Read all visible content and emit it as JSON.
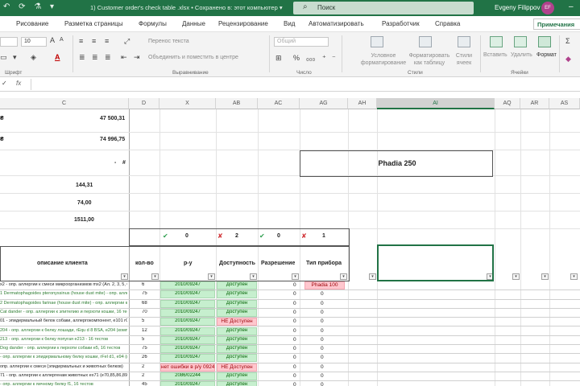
{
  "titlebar": {
    "quick_access": "↶ ⟳ ⚗ ▾",
    "document": "1) Customer order's check table .xlsx • Сохранено в: этот компьютер ▾",
    "search_placeholder": "Поиск",
    "user_name": "Evgeny Filippov",
    "avatar_initials": "EF"
  },
  "tabs": [
    "Рисование",
    "Разметка страницы",
    "Формулы",
    "Данные",
    "Рецензирование",
    "Вид",
    "Автоматизировать",
    "Разработчик",
    "Справка"
  ],
  "comments_button": "Примечания",
  "ribbon": {
    "font_size": "10",
    "wrap_text": "Перенос текста",
    "merge_center": "Объединить и поместить в центре",
    "number_format": "Общий",
    "conditional_format": "Условное форматирование",
    "format_as_table": "Форматировать как таблицу",
    "cell_styles": "Стили ячеек",
    "insert": "Вставить",
    "delete": "Удалить",
    "format": "Формат",
    "group_font": "Шрифт",
    "group_align": "Выравнивание",
    "group_number": "Число",
    "group_styles": "Стили",
    "group_cells": "Ячейки"
  },
  "formula_bar": {
    "fx": "fx"
  },
  "columns": [
    {
      "label": "C",
      "selected": false
    },
    {
      "label": "D",
      "selected": false
    },
    {
      "label": "X",
      "selected": false
    },
    {
      "label": "AB",
      "selected": false
    },
    {
      "label": "AC",
      "selected": false
    },
    {
      "label": "AG",
      "selected": false
    },
    {
      "label": "AH",
      "selected": false
    },
    {
      "label": "AI",
      "selected": true
    },
    {
      "label": "AQ",
      "selected": false
    },
    {
      "label": "AR",
      "selected": false
    },
    {
      "label": "AS",
      "selected": false
    }
  ],
  "summary": {
    "value1": "47 500,31",
    "value2": "74 996,75",
    "value3": "-",
    "hash": "#",
    "value4": "144,31",
    "value5": "74,00",
    "value6": "1511,00"
  },
  "phadia_title": "Phadia 250",
  "counters": {
    "x_ok": "✔",
    "x_value": "0",
    "ab_bad": "✘",
    "ab_value": "2",
    "ac_ok": "✔",
    "ac_value": "0",
    "ag_bad": "✘",
    "ag_value": "1"
  },
  "headers": {
    "c": "описание клиента",
    "d": "кол-во",
    "x": "р-у",
    "ab": "Доступность",
    "ac": "Разрешение",
    "ag": "Тип прибора"
  },
  "filter_glyph": "▾",
  "rows": [
    {
      "c": "х2 - опр. аллергии к смеси микроорганизмов mx2 (Ал. 2, 3, 5, 6,",
      "d": "6",
      "x": "2010/09247",
      "ab": "Доступен",
      "ab_bad": false,
      "ac": "0",
      "ag": "Phadia 100",
      "ag_bad": true,
      "c_green": false,
      "x_bad": false
    },
    {
      "c": "1 Dermatophagoides pteronyssinus (house dust mite) - опр. аллерги",
      "d": "75",
      "x": "2010/09247",
      "ab": "Доступен",
      "ab_bad": false,
      "ac": "0",
      "ag": "0",
      "ag_bad": false,
      "c_green": true,
      "x_bad": false
    },
    {
      "c": "2 Dermatophagoides farinae (house dust mite) - опр. аллергии к",
      "d": "68",
      "x": "2010/09247",
      "ab": "Доступен",
      "ab_bad": false,
      "ac": "0",
      "ag": "0",
      "ag_bad": false,
      "c_green": true,
      "x_bad": false
    },
    {
      "c": "Cat dander - опр. аллергии к эпителию и перхоти кошки, 16 тес",
      "d": "70",
      "x": "2010/09247",
      "ab": "Доступен",
      "ab_bad": false,
      "ac": "0",
      "ag": "0",
      "ag_bad": false,
      "c_green": true,
      "x_bad": false
    },
    {
      "c": "01 - эпидермальный белок собаки, аллергокомпонент, e101 rCa",
      "d": "5",
      "x": "2010/09247",
      "ab": "НЕ Доступен",
      "ab_bad": true,
      "ac": "0",
      "ag": "0",
      "ag_bad": false,
      "c_green": false,
      "x_bad": false
    },
    {
      "c": "204 - опр. аллергии к белку лошади, rEqu d 8 BSA, e204 (комп",
      "d": "12",
      "x": "2010/09247",
      "ab": "Доступен",
      "ab_bad": false,
      "ac": "0",
      "ag": "0",
      "ag_bad": false,
      "c_green": true,
      "x_bad": false
    },
    {
      "c": "213 - опр. аллергии к белку попугая е213 - 16 тестов",
      "d": "5",
      "x": "2010/09247",
      "ab": "Доступен",
      "ab_bad": false,
      "ac": "0",
      "ag": "0",
      "ag_bad": false,
      "c_green": true,
      "x_bad": false
    },
    {
      "c": "Dog dander - опр. аллергии к перхоти собаки е5, 16 тестов",
      "d": "75",
      "x": "2010/09247",
      "ab": "Доступен",
      "ab_bad": false,
      "ac": "0",
      "ag": "0",
      "ag_bad": false,
      "c_green": true,
      "x_bad": false
    },
    {
      "c": "- опр. аллергии к эпидермальному белку кошки, rFel d1, e94 (к",
      "d": "26",
      "x": "2010/09247",
      "ab": "Доступен",
      "ab_bad": false,
      "ac": "0",
      "ag": "0",
      "ag_bad": false,
      "c_green": true,
      "x_bad": false
    },
    {
      "c": "опр. аллергии к смеси (эпидермальных и животных белков)",
      "d": "2",
      "x": "нет ошибки в р/у 09247)",
      "ab": "НЕ Доступен",
      "ab_bad": true,
      "ac": "0",
      "ag": "0",
      "ag_bad": false,
      "c_green": false,
      "x_bad": true
    },
    {
      "c": "71 - опр. аллергии к аллергенам животных ex71 (e70,85,86,89)",
      "d": "2",
      "x": "2086/02244",
      "ab": "Доступен",
      "ab_bad": false,
      "ac": "0",
      "ag": "0",
      "ag_bad": false,
      "c_green": false,
      "x_bad": false
    },
    {
      "c": "- опр. аллергии к яичному белку f1, 16 тестов",
      "d": "45",
      "x": "2010/09247",
      "ab": "Доступен",
      "ab_bad": false,
      "ac": "0",
      "ag": "0",
      "ag_bad": false,
      "c_green": true,
      "x_bad": false
    }
  ]
}
